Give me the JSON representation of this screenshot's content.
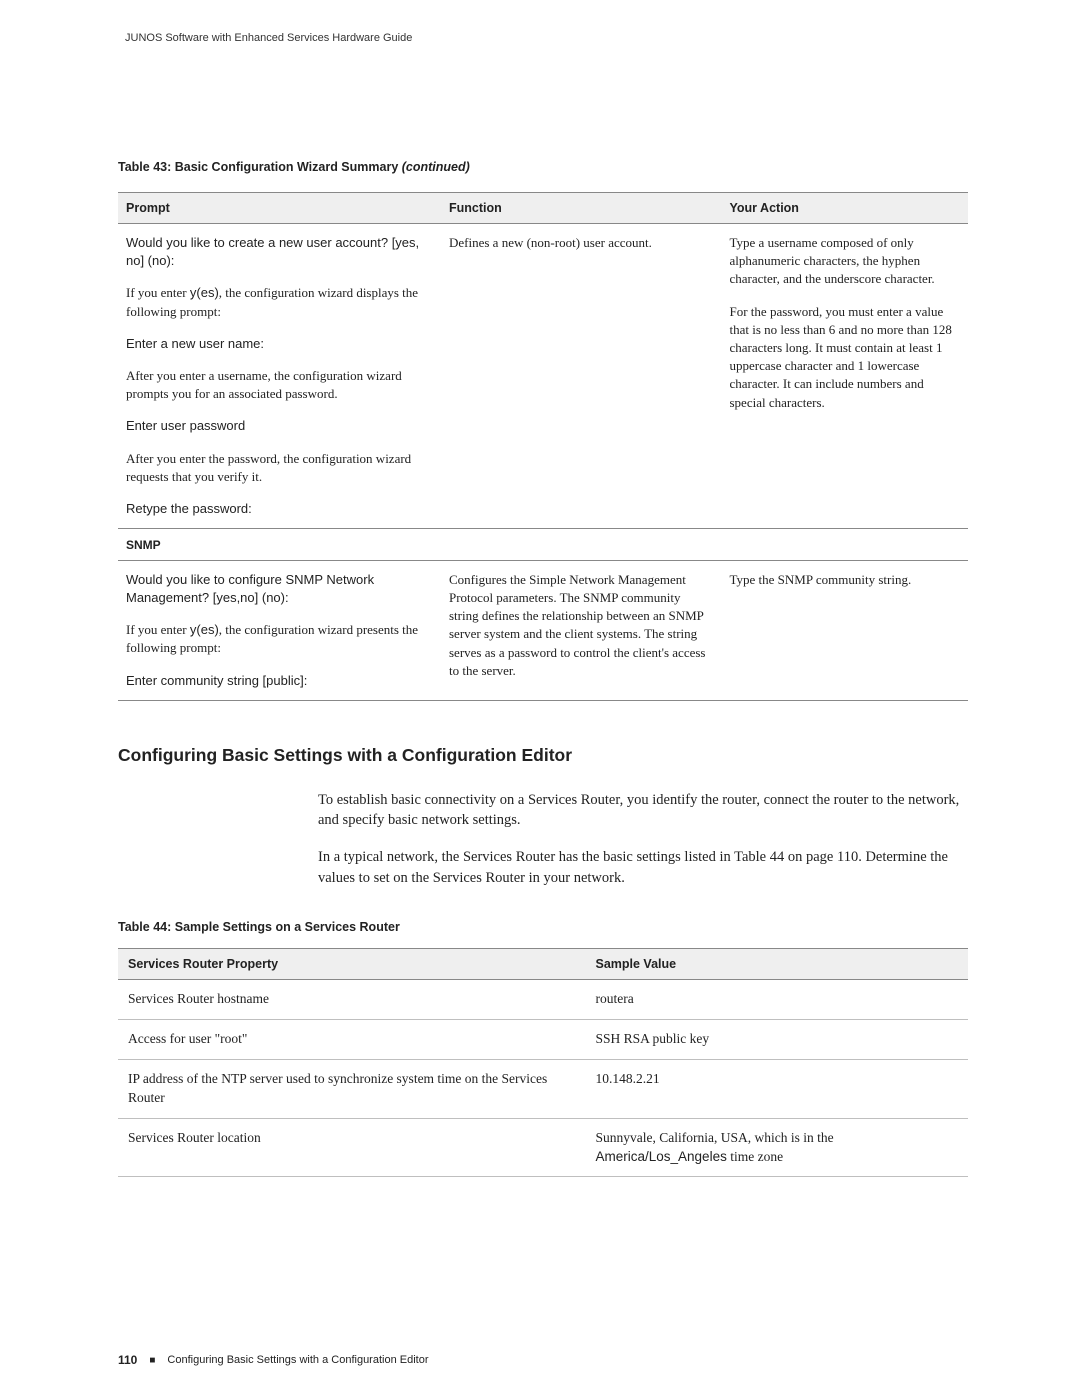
{
  "header": "JUNOS Software with Enhanced Services Hardware Guide",
  "table43": {
    "title_prefix": "Table 43: Basic Configuration Wizard Summary ",
    "title_suffix": "(continued)",
    "cols": {
      "c1": "Prompt",
      "c2": "Function",
      "c3": "Your Action"
    },
    "row1": {
      "p1a": "Would you like to create a new user account? [yes, no] (no):",
      "p1b_pre": "If you enter ",
      "p1b_bold": "y(es)",
      "p1b_post": ", the configuration wizard displays the following prompt:",
      "p1c": "Enter a new user name:",
      "p1d": "After you enter a username, the configuration wizard prompts you for an associated password.",
      "p1e": "Enter user password",
      "p1f": "After you enter the password, the configuration wizard requests that you verify it.",
      "p1g": "Retype the password:",
      "func": "Defines a new (non-root) user account.",
      "act_a": "Type a username composed of only alphanumeric characters, the hyphen character, and the underscore character.",
      "act_b": "For the password, you must enter a value that is no less than 6 and no more than 128 characters long. It must contain at least 1 uppercase character and 1 lowercase character. It can include numbers and special characters."
    },
    "snmp_label": "SNMP",
    "row2": {
      "p1a": "Would you like to configure SNMP Network Management? [yes,no] (no):",
      "p1b_pre": "If you enter ",
      "p1b_bold": "y(es)",
      "p1b_post": ", the configuration wizard presents the following prompt:",
      "p1c": "Enter community string [public]:",
      "func": "Configures the Simple Network Management Protocol parameters. The SNMP community string defines the relationship between an SNMP server system and the client systems. The string serves as a password to control the client's access to the server.",
      "act": "Type the SNMP community string."
    }
  },
  "section_heading": "Configuring Basic Settings with a Configuration Editor",
  "body": {
    "p1": "To establish basic connectivity on a Services Router, you identify the router, connect the router to the network, and specify basic network settings.",
    "p2": "In a typical network, the Services Router has the basic settings listed in Table 44 on page 110. Determine the values to set on the Services Router in your network."
  },
  "table44": {
    "title": "Table 44:  Sample Settings on a Services Router",
    "cols": {
      "c1": "Services Router Property",
      "c2": "Sample Value"
    },
    "rows": [
      {
        "prop": "Services Router hostname",
        "val_plain": "routera",
        "val_mono": "",
        "val_tail": ""
      },
      {
        "prop": "Access for user \"root\"",
        "val_plain": "SSH RSA public key",
        "val_mono": "",
        "val_tail": ""
      },
      {
        "prop": "IP address of the NTP server used to synchronize system time on the Services Router",
        "val_plain": "10.148.2.21",
        "val_mono": "",
        "val_tail": ""
      },
      {
        "prop": "Services Router location",
        "val_plain": "Sunnyvale, California, USA, which is in the ",
        "val_mono": "America/Los_Angeles",
        "val_tail": " time zone"
      }
    ]
  },
  "footer": {
    "page": "110",
    "text": "Configuring Basic Settings with a Configuration Editor"
  }
}
